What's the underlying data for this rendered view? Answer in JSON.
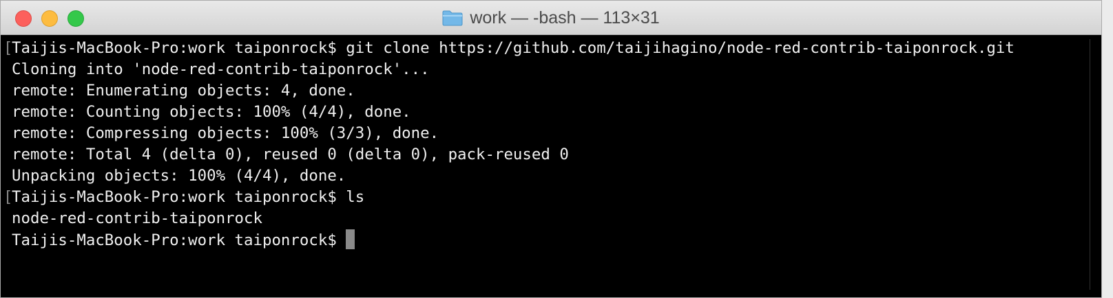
{
  "window": {
    "title": "work — -bash — 113×31",
    "folder_icon": "folder-icon"
  },
  "terminal": {
    "lines": [
      "Taijis-MacBook-Pro:work taiponrock$ git clone https://github.com/taijihagino/node-red-contrib-taiponrock.git",
      "Cloning into 'node-red-contrib-taiponrock'...",
      "remote: Enumerating objects: 4, done.",
      "remote: Counting objects: 100% (4/4), done.",
      "remote: Compressing objects: 100% (3/3), done.",
      "remote: Total 4 (delta 0), reused 0 (delta 0), pack-reused 0",
      "Unpacking objects: 100% (4/4), done.",
      "Taijis-MacBook-Pro:work taiponrock$ ls",
      "node-red-contrib-taiponrock",
      "Taijis-MacBook-Pro:work taiponrock$ "
    ]
  }
}
